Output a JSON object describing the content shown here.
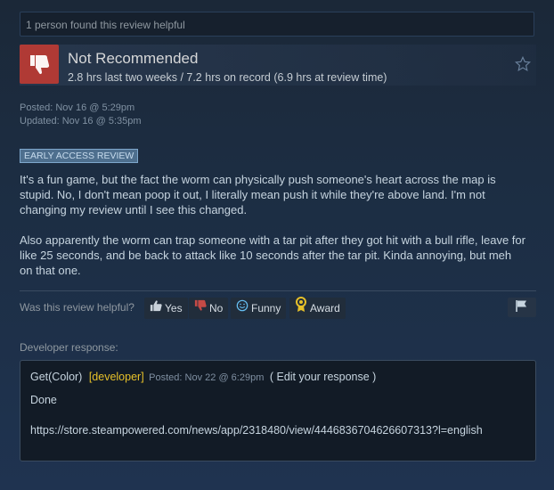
{
  "helpful_count": "1 person found this review helpful",
  "review": {
    "verdict": "Not Recommended",
    "hours": "2.8 hrs last two weeks / 7.2 hrs on record (6.9 hrs at review time)",
    "posted": "Posted: Nov 16 @ 5:29pm",
    "updated": "Updated: Nov 16 @ 5:35pm",
    "badge": "EARLY ACCESS REVIEW",
    "paragraphs": [
      "It's a fun game, but the fact the worm can physically push someone's heart across the map is stupid. No, I don't mean poop it out, I literally mean push it while they're above land. I'm not changing my review until I see this changed.",
      "Also apparently the worm can trap someone with a tar pit after they got hit with a bull rifle, leave for like 25 seconds, and be back to attack like 10 seconds after the tar pit. Kinda annoying, but meh on that one."
    ]
  },
  "vote": {
    "question": "Was this review helpful?",
    "yes": "Yes",
    "no": "No",
    "funny": "Funny",
    "award": "Award"
  },
  "developer": {
    "label": "Developer response:",
    "name": "Get(Color)",
    "tag": "[developer]",
    "posted": "Posted: Nov 22 @ 6:29pm",
    "edit": "( Edit your response )",
    "line1": "Done",
    "url": "https://store.steampowered.com/news/app/2318480/view/4446836704626607313?l=english"
  },
  "colors": {
    "thumb_down_bg": "#b03a35",
    "developer_tag": "#e6c029",
    "badge_bg": "#4e6f8e"
  },
  "icons": [
    "thumbs-down-icon",
    "star-icon",
    "thumbs-up-icon",
    "funny-icon",
    "award-icon",
    "flag-icon"
  ]
}
